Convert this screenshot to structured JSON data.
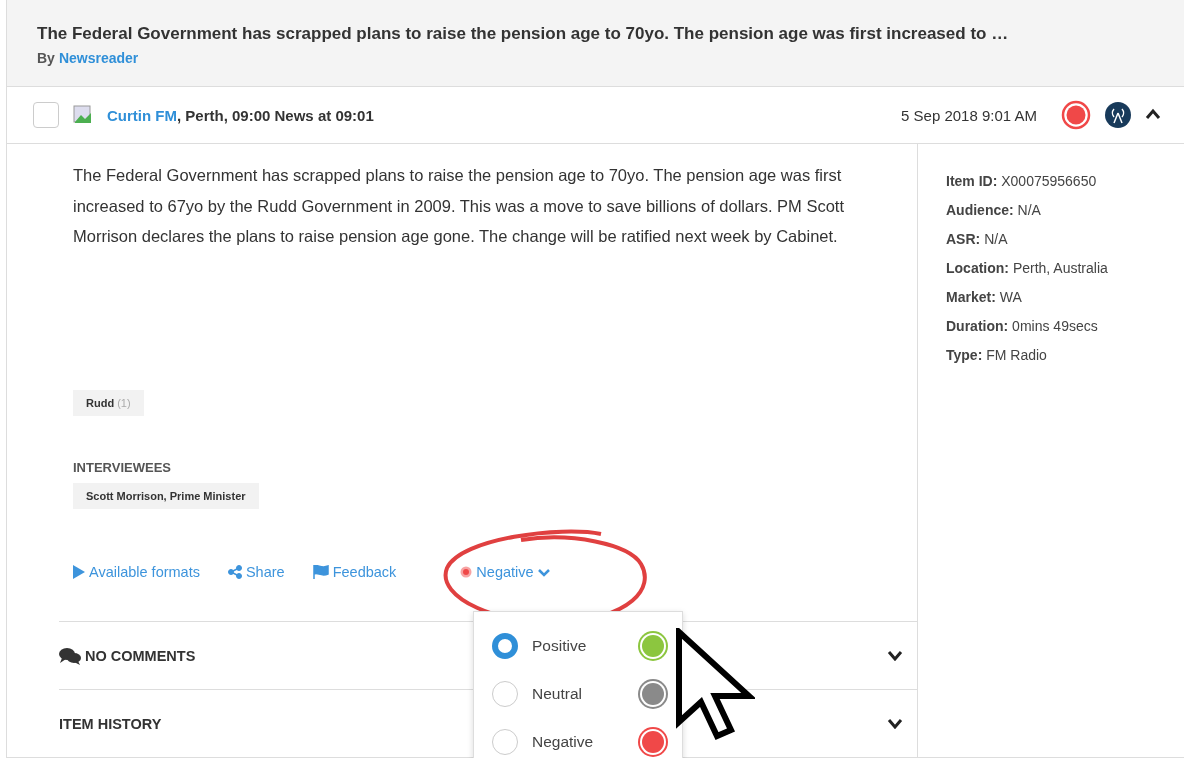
{
  "header": {
    "title": "The Federal Government has scrapped plans to raise the pension age to 70yo. The pension age was first increased to …",
    "by_label": "By",
    "author": "Newsreader"
  },
  "item": {
    "checked": false,
    "station": "Curtin FM",
    "details": ", Perth, 09:00 News at 09:01",
    "date": "5 Sep 2018 9:01 AM",
    "expanded": true
  },
  "summary": "The Federal Government has scrapped plans to raise the pension age to 70yo. The pension age was first increased to 67yo by the Rudd Government in 2009. This was a move to save billions of dollars. PM Scott Morrison declares the plans to raise pension age gone. The change will be ratified next week by Cabinet.",
  "tags": [
    {
      "label": "Rudd",
      "count": "(1)"
    }
  ],
  "interviewees": {
    "heading": "INTERVIEWEES",
    "items": [
      "Scott Morrison, Prime Minister"
    ]
  },
  "actions": [
    {
      "kind": "formats",
      "label": "Available formats"
    },
    {
      "kind": "share",
      "label": "Share"
    },
    {
      "kind": "feedback",
      "label": "Feedback"
    }
  ],
  "sentiment": {
    "label": "Negative",
    "color": "#f04848",
    "options": [
      {
        "label": "Positive",
        "selected": true,
        "color": "#8cc63f"
      },
      {
        "label": "Neutral",
        "selected": false,
        "color": "#8a8a8a"
      },
      {
        "label": "Negative",
        "selected": false,
        "color": "#f04848"
      }
    ]
  },
  "sections": [
    {
      "kind": "comments",
      "label": "NO COMMENTS",
      "expanded": false
    },
    {
      "kind": "history",
      "label": "ITEM HISTORY",
      "expanded": false
    }
  ],
  "meta": [
    {
      "key": "Item ID:",
      "value": "X00075956650"
    },
    {
      "key": "Audience:",
      "value": "N/A"
    },
    {
      "key": "ASR:",
      "value": "N/A"
    },
    {
      "key": "Location:",
      "value": "Perth, Australia"
    },
    {
      "key": "Market:",
      "value": "WA"
    },
    {
      "key": "Duration:",
      "value": "0mins 49secs"
    },
    {
      "key": "Type:",
      "value": "FM Radio"
    }
  ]
}
